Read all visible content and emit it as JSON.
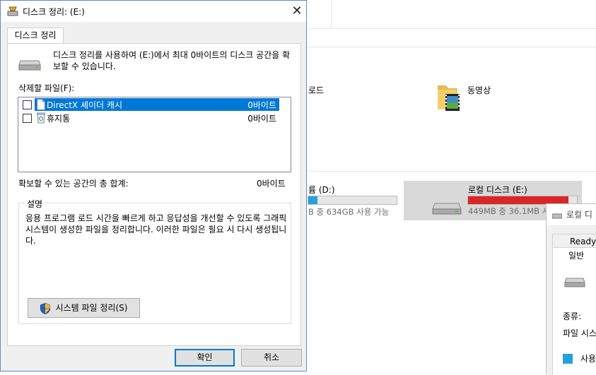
{
  "explorer": {
    "quick_item_partial": "로드",
    "folder_label": "동영상",
    "drive_d": {
      "name_partial": "륨 (D:)",
      "info_partial": "B 중 634GB 사용 가능",
      "used_fraction": 0.1,
      "bar_color": "#26a0da"
    },
    "drive_e": {
      "name": "로컬 디스크 (E:)",
      "info_partial": "449MB 중 36.1MB 사",
      "used_fraction": 0.92,
      "bar_color": "#da2626"
    }
  },
  "properties_window": {
    "title_partial": "로컬 디",
    "tab_partial": "ReadyB",
    "general_tab": "일반",
    "type_label": "종류:",
    "fs_label_partial": "파일 시스",
    "used_label_partial": "사용",
    "used_color": "#26a0da"
  },
  "dialog": {
    "title": "디스크 정리: (E:)",
    "tab": "디스크 정리",
    "description": "디스크 정리를 사용하여 (E:)에서 최대 0바이트의 디스크 공간을 확보할 수 있습니다.",
    "files_label": "삭제할 파일(F):",
    "files": [
      {
        "label": "DirectX 셰이더 캐시",
        "size": "0바이트",
        "checked": false,
        "selected": true,
        "icon": "file-icon"
      },
      {
        "label": "휴지통",
        "size": "0바이트",
        "checked": false,
        "selected": false,
        "icon": "recycle-bin-icon"
      }
    ],
    "total_label": "확보할 수 있는 공간의 총 합계:",
    "total_value": "0바이트",
    "group_caption": "설명",
    "group_text": "응용 프로그램 로드 시간을 빠르게 하고 응답성을 개선할 수 있도록 그래픽 시스템이 생성한 파일을 정리합니다. 이러한 파일은 필요 시 다시 생성됩니다.",
    "system_button": "시스템 파일 정리(S)",
    "ok_button": "확인",
    "cancel_button": "취소",
    "accent_color": "#0078d7"
  }
}
